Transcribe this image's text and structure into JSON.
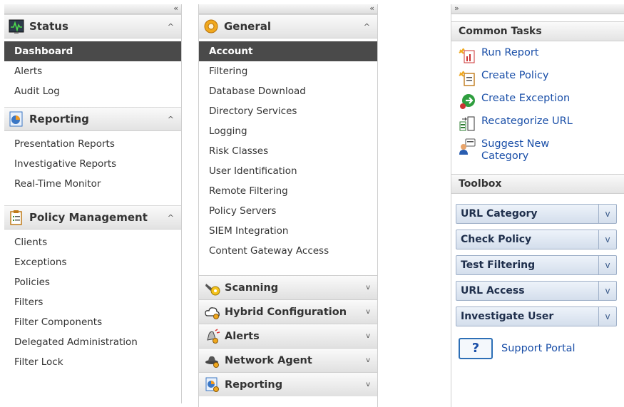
{
  "left": {
    "collapse_glyph": "«",
    "sections": [
      {
        "title": "Status",
        "icon": "status-monitor-icon",
        "chevron": "^",
        "items": [
          "Dashboard",
          "Alerts",
          "Audit Log"
        ],
        "selected": 0
      },
      {
        "title": "Reporting",
        "icon": "reporting-chart-icon",
        "chevron": "^",
        "items": [
          "Presentation Reports",
          "Investigative Reports",
          "Real-Time Monitor"
        ]
      },
      {
        "title": "Policy Management",
        "icon": "policy-clipboard-icon",
        "chevron": "^",
        "items": [
          "Clients",
          "Exceptions",
          "Policies",
          "Filters",
          "Filter Components",
          "Delegated Administration",
          "Filter Lock"
        ]
      }
    ]
  },
  "middle": {
    "collapse_glyph": "«",
    "general": {
      "title": "General",
      "icon": "general-gear-icon",
      "chevron": "^",
      "items": [
        "Account",
        "Filtering",
        "Database Download",
        "Directory Services",
        "Logging",
        "Risk Classes",
        "User Identification",
        "Remote Filtering",
        "Policy Servers",
        "SIEM Integration",
        "Content Gateway Access"
      ],
      "selected": 0
    },
    "collapsed_sections": [
      {
        "title": "Scanning",
        "icon": "scanning-flashlight-icon",
        "chevron": "v"
      },
      {
        "title": "Hybrid Configuration",
        "icon": "hybrid-cloud-icon",
        "chevron": "v"
      },
      {
        "title": "Alerts",
        "icon": "alerts-bell-icon",
        "chevron": "v"
      },
      {
        "title": "Network Agent",
        "icon": "network-agent-hat-icon",
        "chevron": "v"
      },
      {
        "title": "Reporting",
        "icon": "reporting-settings-icon",
        "chevron": "v"
      }
    ]
  },
  "right": {
    "collapse_glyph": "»",
    "common_tasks": {
      "title": "Common Tasks",
      "items": [
        {
          "label": "Run Report",
          "icon": "run-report-icon"
        },
        {
          "label": "Create Policy",
          "icon": "create-policy-icon"
        },
        {
          "label": "Create Exception",
          "icon": "create-exception-icon"
        },
        {
          "label": "Recategorize URL",
          "icon": "recategorize-url-icon"
        },
        {
          "label": "Suggest New Category",
          "icon": "suggest-category-icon"
        }
      ]
    },
    "toolbox": {
      "title": "Toolbox",
      "tools": [
        "URL Category",
        "Check Policy",
        "Test Filtering",
        "URL Access",
        "Investigate User"
      ],
      "dropdown_glyph": "v"
    },
    "support": {
      "label": "Support Portal",
      "icon_text": "?"
    }
  },
  "colors": {
    "selected_bg": "#4a4a4a",
    "link": "#1a4fa8",
    "tool_border": "#9fb0c8"
  }
}
